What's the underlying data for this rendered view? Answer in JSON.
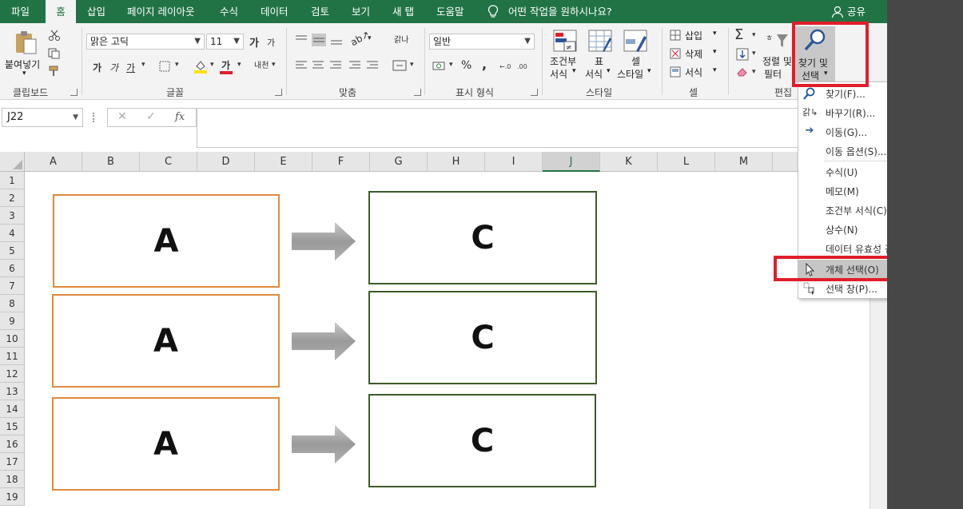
{
  "tabs": [
    {
      "label": "파일",
      "active": false
    },
    {
      "label": "홈",
      "active": true
    },
    {
      "label": "삽입",
      "active": false
    },
    {
      "label": "페이지 레이아웃",
      "active": false
    },
    {
      "label": "수식",
      "active": false
    },
    {
      "label": "데이터",
      "active": false
    },
    {
      "label": "검토",
      "active": false
    },
    {
      "label": "보기",
      "active": false
    },
    {
      "label": "새 탭",
      "active": false
    },
    {
      "label": "도움말",
      "active": false
    }
  ],
  "tell_me": "어떤 작업을 원하시나요?",
  "share": "공유",
  "ribbon": {
    "paste_label": "붙여넣기",
    "font_name": "맑은 고딕",
    "font_size": "11",
    "number_format": "일반",
    "cond_format": [
      "조건부",
      "서식"
    ],
    "table_format": [
      "표",
      "서식"
    ],
    "cell_style": [
      "셀",
      "스타일"
    ],
    "insert": "삽입",
    "delete": "삭제",
    "format": "서식",
    "sort_filter": [
      "정렬 및",
      "필터"
    ],
    "find_select": [
      "찾기 및",
      "선택"
    ],
    "bold_glyph": "가",
    "italic_glyph": "가",
    "underline_glyph": "가",
    "grow_glyph": "가",
    "shrink_glyph": "가",
    "font_color_glyph": "가",
    "phonetic_glyph": "내천",
    "wrap_glyph": "갉나",
    "percent": "%",
    "comma": ",",
    "groups": {
      "clipboard": "클립보드",
      "font": "글꼴",
      "alignment": "맞춤",
      "number": "표시 형식",
      "styles": "스타일",
      "cells": "셀",
      "editing": "편집"
    }
  },
  "formula_bar": {
    "name_box": "J22",
    "fx": "fx",
    "cancel": "✕",
    "enter": "✓",
    "value": ""
  },
  "columns": [
    "A",
    "B",
    "C",
    "D",
    "E",
    "F",
    "G",
    "H",
    "I",
    "J",
    "K",
    "L",
    "M"
  ],
  "selected_column": "J",
  "rows": [
    "1",
    "2",
    "3",
    "4",
    "5",
    "6",
    "7",
    "8",
    "9",
    "10",
    "11",
    "12",
    "13",
    "14",
    "15",
    "16",
    "17",
    "18",
    "19"
  ],
  "shapes": {
    "left_boxes": [
      "A",
      "A",
      "A"
    ],
    "right_boxes": [
      "C",
      "C",
      "C"
    ]
  },
  "find_menu": {
    "items": [
      {
        "label": "찾기(F)...",
        "icon": "search-icon"
      },
      {
        "label": "바꾸기(R)...",
        "icon": "replace-icon"
      },
      {
        "label": "이동(G)...",
        "icon": "arrow-right-icon"
      },
      {
        "label": "이동 옵션(S)...",
        "icon": ""
      },
      {
        "label": "수식(U)",
        "icon": ""
      },
      {
        "label": "메모(M)",
        "icon": ""
      },
      {
        "label": "조건부 서식(C)",
        "icon": ""
      },
      {
        "label": "상수(N)",
        "icon": ""
      },
      {
        "label": "데이터 유효성 검사(V)",
        "icon": ""
      },
      {
        "label": "개체 선택(O)",
        "icon": "cursor-icon",
        "highlighted": true
      },
      {
        "label": "선택 창(P)...",
        "icon": "selection-pane-icon"
      }
    ]
  },
  "colors": {
    "accent": "#217346",
    "highlight_red": "#e01e2a",
    "box_orange": "#e08a3c",
    "box_green": "#3e5b2a"
  }
}
